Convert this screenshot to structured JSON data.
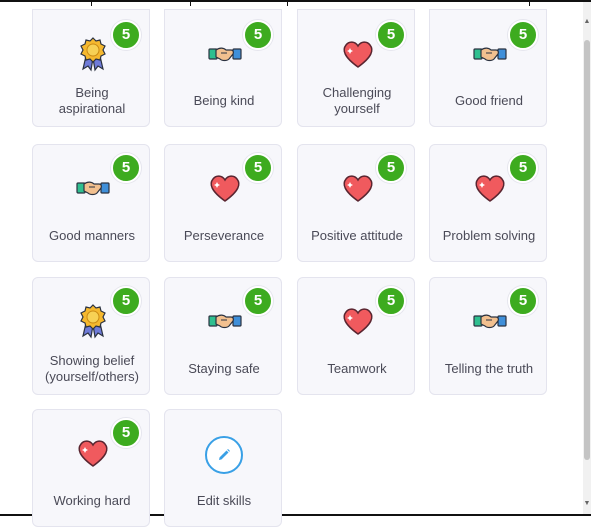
{
  "skills": [
    {
      "label": "Being aspirational",
      "icon": "medal-icon",
      "count": "5"
    },
    {
      "label": "Being kind",
      "icon": "handshake-icon",
      "count": "5"
    },
    {
      "label": "Challenging yourself",
      "icon": "heart-icon",
      "count": "5"
    },
    {
      "label": "Good friend",
      "icon": "handshake-icon",
      "count": "5"
    },
    {
      "label": "Good manners",
      "icon": "handshake-icon",
      "count": "5"
    },
    {
      "label": "Perseverance",
      "icon": "heart-icon",
      "count": "5"
    },
    {
      "label": "Positive attitude",
      "icon": "heart-icon",
      "count": "5"
    },
    {
      "label": "Problem solving",
      "icon": "heart-icon",
      "count": "5"
    },
    {
      "label": "Showing belief (yourself/others)",
      "icon": "medal-icon",
      "count": "5"
    },
    {
      "label": "Staying safe",
      "icon": "handshake-icon",
      "count": "5"
    },
    {
      "label": "Teamwork",
      "icon": "heart-icon",
      "count": "5"
    },
    {
      "label": "Telling the truth",
      "icon": "handshake-icon",
      "count": "5"
    },
    {
      "label": "Working hard",
      "icon": "heart-icon",
      "count": "5"
    }
  ],
  "edit": {
    "label": "Edit skills",
    "icon": "pencil-icon"
  },
  "colors": {
    "badge": "#3dab1f",
    "card_bg": "#f7f7fb",
    "edit_accent": "#39a0e6",
    "heart": "#f05a5e"
  }
}
